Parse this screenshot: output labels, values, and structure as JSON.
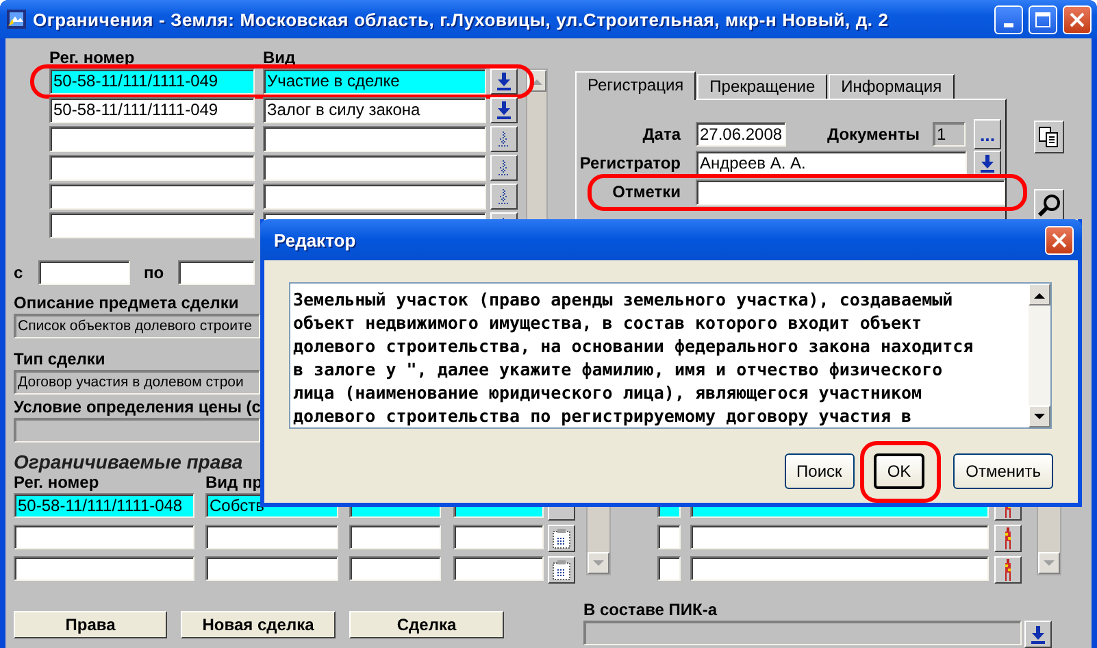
{
  "window": {
    "title": "Ограничения - Земля: Московская область, г.Луховицы, ул.Строительная, мкр-н Новый, д. 2"
  },
  "deals": {
    "columns": [
      "Рег. номер",
      "Вид"
    ],
    "rows": [
      {
        "reg": "50-58-11/111/1111-049",
        "type": "Участие в сделке",
        "selected": true,
        "circled": true,
        "disabled": false
      },
      {
        "reg": "50-58-11/111/1111-049",
        "type": "Залог в силу закона",
        "selected": false,
        "circled": false,
        "disabled": false
      },
      {
        "selected": false,
        "circled": false,
        "disabled": true
      },
      {
        "selected": false,
        "circled": false,
        "disabled": true
      },
      {
        "selected": false,
        "circled": false,
        "disabled": true
      },
      {
        "selected": false,
        "circled": false,
        "disabled": true
      }
    ]
  },
  "period": {
    "from_label": "с",
    "to_label": "по"
  },
  "description": {
    "label": "Описание предмета сделки",
    "value": "Список объектов долевого строите"
  },
  "deal_type": {
    "label": "Тип сделки",
    "value": "Договор участия в долевом строи"
  },
  "price_condition": {
    "label": "Условие определения цены (с"
  },
  "restricted_rights": {
    "title": "Ограничиваемые права",
    "columns": [
      "Рег. номер",
      "Вид пр"
    ],
    "rows": [
      {
        "reg": "50-58-11/111/1111-048",
        "right": "Собств",
        "selected": true
      },
      {
        "selected": false
      },
      {
        "selected": false
      }
    ]
  },
  "buttons": [
    "Права",
    "Новая сделка",
    "Сделка"
  ],
  "tabs": [
    {
      "label": "Регистрация",
      "selected": true
    },
    {
      "label": "Прекращение",
      "selected": false
    },
    {
      "label": "Информация",
      "selected": false
    }
  ],
  "registration": {
    "date_label": "Дата",
    "date": "27.06.2008",
    "documents_label": "Документы",
    "documents": "1",
    "documents_button": "...",
    "registrar_label": "Регистратор",
    "registrar": "Андреев А. А.",
    "notes_label": "Отметки",
    "notes_circled": true
  },
  "pik": {
    "label": "В составе ПИК-а"
  },
  "dialog": {
    "title": "Редактор",
    "text": "Земельный участок (право аренды земельного участка), создаваемый\nобъект недвижимого имущества, в состав которого входит объект\nдолевого строительства, на основании федерального закона находится\nв залоге у \", далее укажите фамилию, имя и отчество физического\nлица (наименование юридического лица), являющегося участником\nдолевого строительства по регистрируемому договору участия в",
    "buttons": [
      {
        "label": "Поиск",
        "default": false,
        "circled": false
      },
      {
        "label": "OK",
        "default": true,
        "circled": true
      },
      {
        "label": "Отменить",
        "default": false,
        "circled": false
      }
    ]
  }
}
